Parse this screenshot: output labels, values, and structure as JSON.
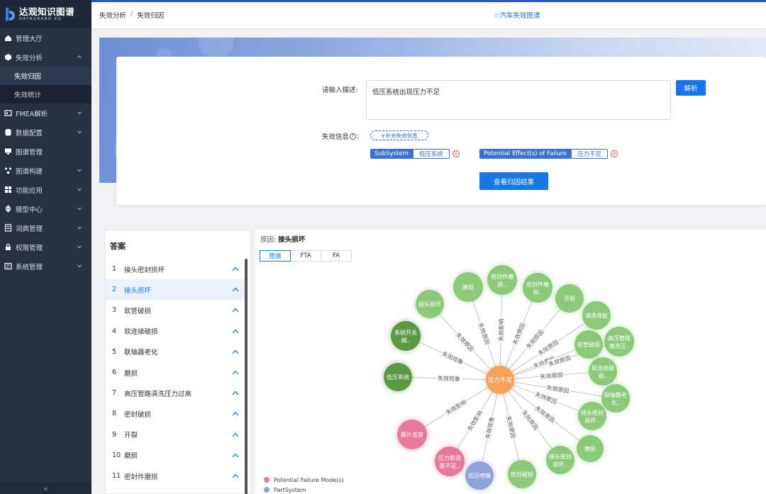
{
  "app": {
    "title": "达观知识图谱",
    "subtitle": "DATAGRAND KG"
  },
  "sidebar": {
    "items": [
      {
        "label": "管理大厅",
        "icon": "home-icon",
        "chevron": false
      },
      {
        "label": "失效分析",
        "icon": "gear-box-icon",
        "chevron": true,
        "expanded": true
      },
      {
        "label": "FMEA解析",
        "icon": "id-card-icon",
        "chevron": true
      },
      {
        "label": "数据配置",
        "icon": "database-icon",
        "chevron": true
      },
      {
        "label": "图谱管理",
        "icon": "monitor-icon",
        "chevron": false
      },
      {
        "label": "图谱构建",
        "icon": "nodes-icon",
        "chevron": true
      },
      {
        "label": "功能应用",
        "icon": "grid-icon",
        "chevron": true
      },
      {
        "label": "模型中心",
        "icon": "model-icon",
        "chevron": true
      },
      {
        "label": "词典管理",
        "icon": "book-icon",
        "chevron": true
      },
      {
        "label": "权限管理",
        "icon": "lock-icon",
        "chevron": true
      },
      {
        "label": "系统管理",
        "icon": "settings-icon",
        "chevron": true
      }
    ],
    "subitems": [
      {
        "label": "失效归因",
        "active": true
      },
      {
        "label": "失效统计",
        "active": false
      }
    ],
    "collapse_glyph": "«"
  },
  "header": {
    "breadcrumb": [
      "失效分析",
      "失效归因"
    ],
    "separator": "/",
    "title": "☆汽车失效图谱"
  },
  "form": {
    "desc_label": "请输入描述:",
    "desc_value": "低压系统出现压力不足",
    "parse_button": "解析",
    "info_label": "失效信息",
    "add_info_button": "+补充失效信息",
    "tags": [
      {
        "key": "SubSystem",
        "value": "低压系统"
      },
      {
        "key": "Potential Effect(s) of Failure",
        "value": "压力不足"
      }
    ],
    "result_button": "查看归因结果"
  },
  "answers": {
    "title": "答案",
    "items": [
      {
        "num": "1",
        "label": "接头密封损坏"
      },
      {
        "num": "2",
        "label": "接头损坏",
        "active": true
      },
      {
        "num": "3",
        "label": "软管破损"
      },
      {
        "num": "4",
        "label": "软连接破损"
      },
      {
        "num": "5",
        "label": "联轴器老化"
      },
      {
        "num": "6",
        "label": "磨损"
      },
      {
        "num": "7",
        "label": "高压管路清洗压力过高"
      },
      {
        "num": "8",
        "label": "密封破损"
      },
      {
        "num": "9",
        "label": "开裂"
      },
      {
        "num": "10",
        "label": "磨损"
      },
      {
        "num": "11",
        "label": "密封件磨损"
      }
    ]
  },
  "graph": {
    "cause_label": "原因:",
    "cause_value": "接头损坏",
    "tabs": [
      "图谱",
      "FTA",
      "FA"
    ],
    "active_tab": 0,
    "center": {
      "label": "压力不足",
      "color": "#f5a35c"
    },
    "nodes": [
      {
        "label": "低压系统",
        "type": "green-dark",
        "edge": "失效现象"
      },
      {
        "label": "系统开关阀..",
        "type": "green-dark",
        "edge": "失效现象"
      },
      {
        "label": "接头损坏",
        "type": "green",
        "edge": "失效原因"
      },
      {
        "label": "磨损",
        "type": "green",
        "edge": "失效原因"
      },
      {
        "label": "密封件磨损..",
        "type": "green",
        "edge": "失效影响"
      },
      {
        "label": "密封件磨损..",
        "type": "green",
        "edge": "失效原因"
      },
      {
        "label": "开裂",
        "type": "green",
        "edge": "失效原因"
      },
      {
        "label": "清洗液脏",
        "type": "green",
        "edge": "失效原因"
      },
      {
        "label": "软管破损",
        "type": "green",
        "edge": "失效原因"
      },
      {
        "label": "高压管路清洗压..",
        "type": "green",
        "edge": "失效原因"
      },
      {
        "label": "软连接破损..",
        "type": "green",
        "edge": "失效原因"
      },
      {
        "label": "联轴器老化..",
        "type": "green",
        "edge": "失效原因"
      },
      {
        "label": "接头密封损坏..",
        "type": "green",
        "edge": "失效原因"
      },
      {
        "label": "磨损",
        "type": "green",
        "edge": "失效原因"
      },
      {
        "label": "接头密封损坏..",
        "type": "green",
        "edge": "失效原因"
      },
      {
        "label": "密封破损",
        "type": "green",
        "edge": "失效原因"
      },
      {
        "label": "低压喷嘴",
        "type": "blue",
        "edge": "失效现象"
      },
      {
        "label": "压力和流量不足..",
        "type": "pink",
        "edge": "失效影响"
      },
      {
        "label": "膜片击穿",
        "type": "pink",
        "edge": "失效影响"
      }
    ],
    "node_colors": {
      "green": "#8cc97a",
      "green-dark": "#5a9a44",
      "blue": "#8fa3d8",
      "pink": "#e8799a"
    },
    "legend": [
      {
        "label": "Potential Failure Mode(s)",
        "color": "#e8799a"
      },
      {
        "label": "PartSystem",
        "color": "#8fa3d8"
      }
    ]
  }
}
